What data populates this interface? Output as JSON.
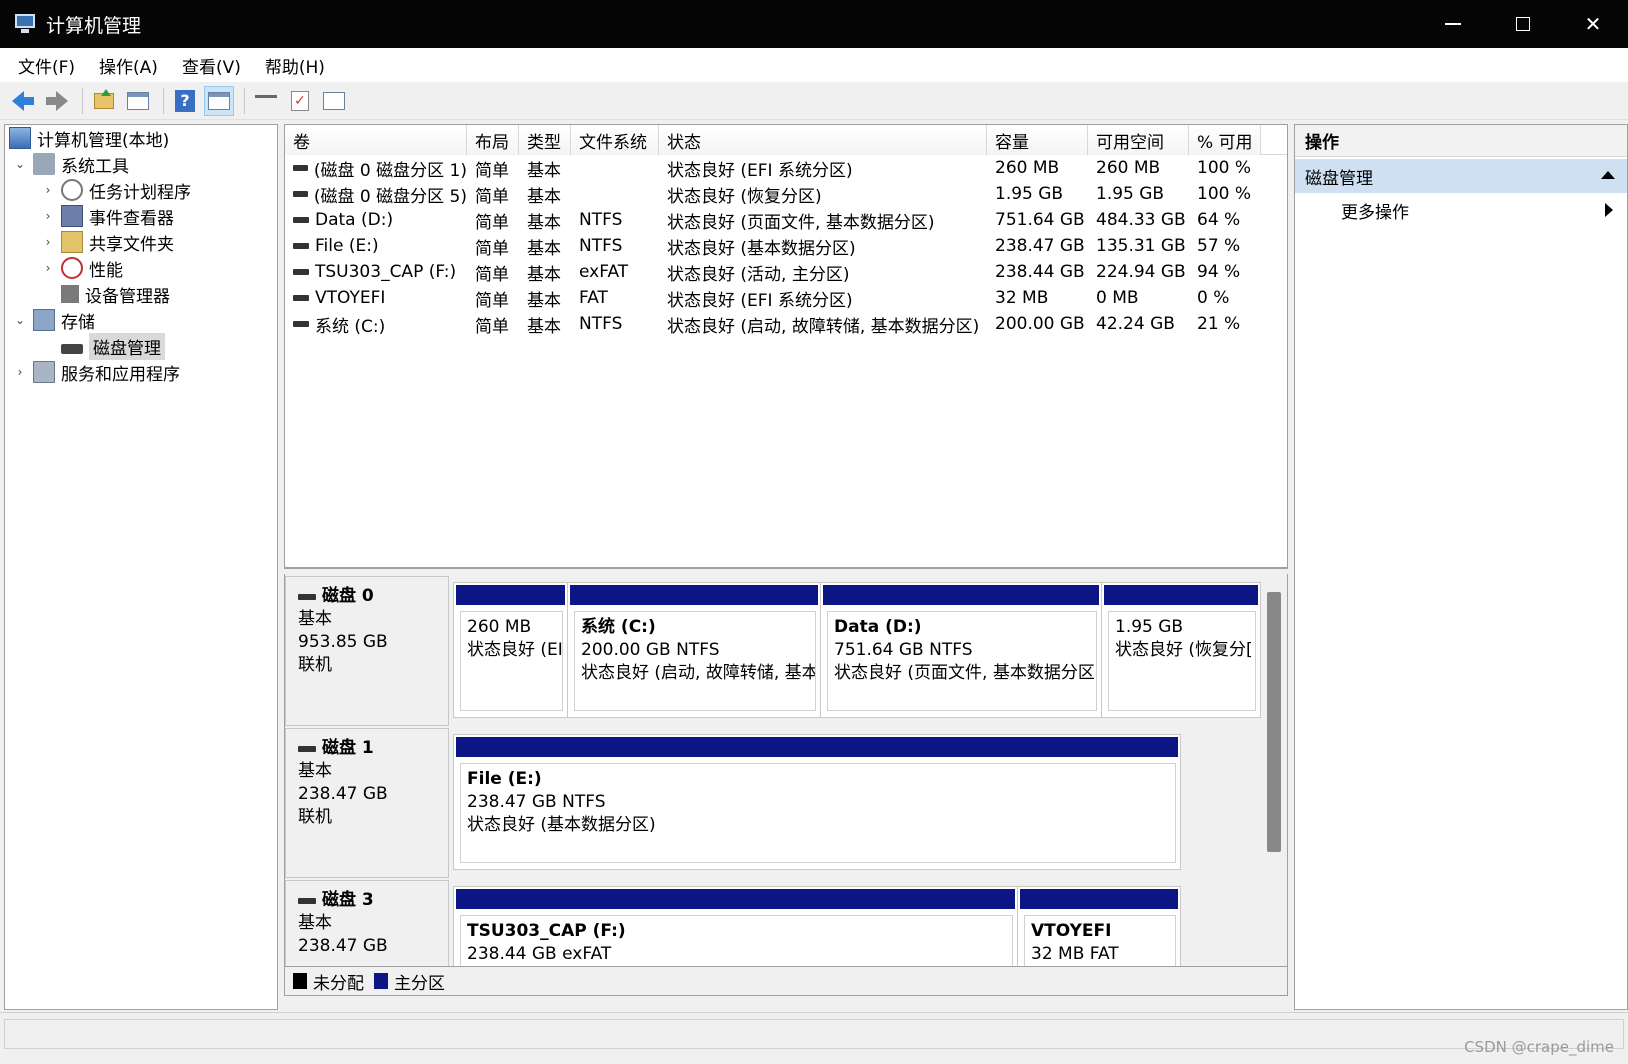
{
  "window": {
    "title": "计算机管理"
  },
  "menu": [
    "文件(F)",
    "操作(A)",
    "查看(V)",
    "帮助(H)"
  ],
  "tree": {
    "root": "计算机管理(本地)",
    "system_tools": "系统工具",
    "task_scheduler": "任务计划程序",
    "event_viewer": "事件查看器",
    "shared_folders": "共享文件夹",
    "performance": "性能",
    "device_manager": "设备管理器",
    "storage": "存储",
    "disk_management": "磁盘管理",
    "services_apps": "服务和应用程序"
  },
  "volumes": {
    "headers": [
      "卷",
      "布局",
      "类型",
      "文件系统",
      "状态",
      "容量",
      "可用空间",
      "% 可用"
    ],
    "rows": [
      [
        "(磁盘 0 磁盘分区 1)",
        "简单",
        "基本",
        "",
        "状态良好 (EFI 系统分区)",
        "260 MB",
        "260 MB",
        "100 %"
      ],
      [
        "(磁盘 0 磁盘分区 5)",
        "简单",
        "基本",
        "",
        "状态良好 (恢复分区)",
        "1.95 GB",
        "1.95 GB",
        "100 %"
      ],
      [
        "Data (D:)",
        "简单",
        "基本",
        "NTFS",
        "状态良好 (页面文件, 基本数据分区)",
        "751.64 GB",
        "484.33 GB",
        "64 %"
      ],
      [
        "File (E:)",
        "简单",
        "基本",
        "NTFS",
        "状态良好 (基本数据分区)",
        "238.47 GB",
        "135.31 GB",
        "57 %"
      ],
      [
        "TSU303_CAP (F:)",
        "简单",
        "基本",
        "exFAT",
        "状态良好 (活动, 主分区)",
        "238.44 GB",
        "224.94 GB",
        "94 %"
      ],
      [
        "VTOYEFI",
        "简单",
        "基本",
        "FAT",
        "状态良好 (EFI 系统分区)",
        "32 MB",
        "0 MB",
        "0 %"
      ],
      [
        "系统 (C:)",
        "简单",
        "基本",
        "NTFS",
        "状态良好 (启动, 故障转储, 基本数据分区)",
        "200.00 GB",
        "42.24 GB",
        "21 %"
      ]
    ]
  },
  "disks": [
    {
      "name": "磁盘 0",
      "type": "基本",
      "size": "953.85 GB",
      "status": "联机",
      "partitions": [
        {
          "title": "",
          "size": "260 MB",
          "status": "状态良好 (EI"
        },
        {
          "title": "系统  (C:)",
          "size": "200.00 GB NTFS",
          "status": "状态良好 (启动, 故障转储, 基本"
        },
        {
          "title": "Data  (D:)",
          "size": "751.64 GB NTFS",
          "status": "状态良好 (页面文件, 基本数据分区"
        },
        {
          "title": "",
          "size": "1.95 GB",
          "status": "状态良好 (恢复分["
        }
      ]
    },
    {
      "name": "磁盘 1",
      "type": "基本",
      "size": "238.47 GB",
      "status": "联机",
      "partitions": [
        {
          "title": "File  (E:)",
          "size": "238.47 GB NTFS",
          "status": "状态良好 (基本数据分区)"
        }
      ]
    },
    {
      "name": "磁盘 3",
      "type": "基本",
      "size": "238.47 GB",
      "status": "",
      "partitions": [
        {
          "title": "TSU303_CAP  (F:)",
          "size": "238.44 GB exFAT",
          "status": ""
        },
        {
          "title": "VTOYEFI",
          "size": "32 MB FAT",
          "status": ""
        }
      ]
    }
  ],
  "legend": {
    "unallocated": "未分配",
    "primary": "主分区",
    "unallocated_color": "#000000",
    "primary_color": "#0b1584"
  },
  "actions": {
    "header": "操作",
    "section": "磁盘管理",
    "more": "更多操作"
  },
  "watermark": "CSDN @crape_dime"
}
